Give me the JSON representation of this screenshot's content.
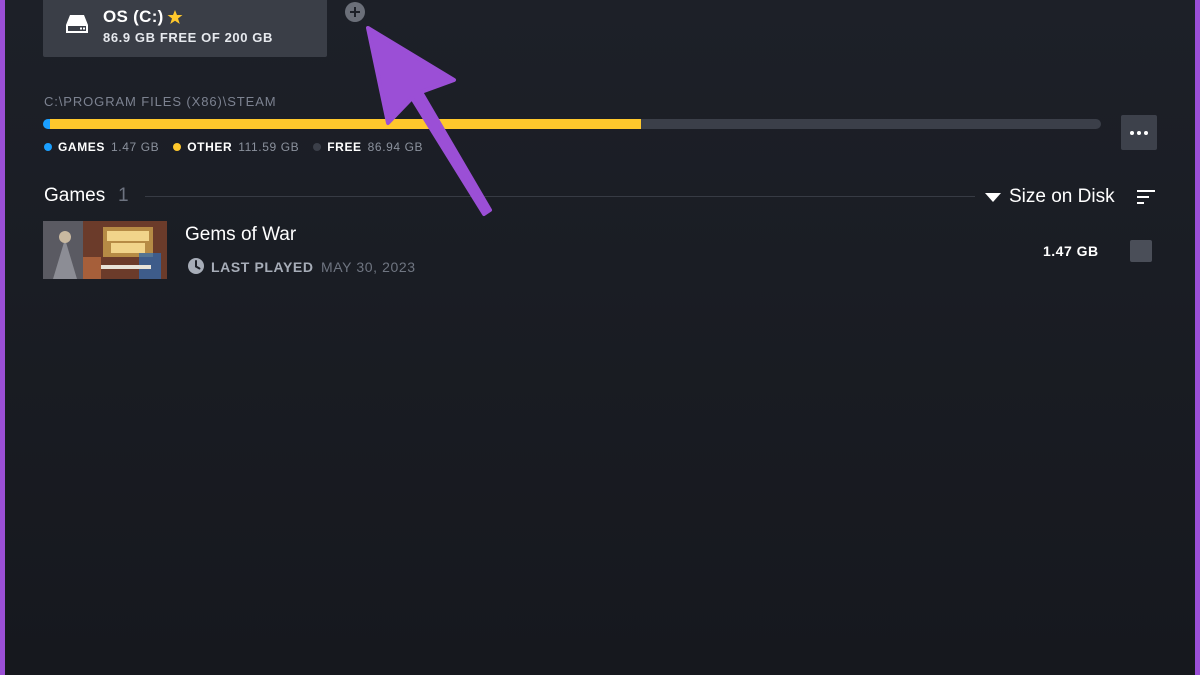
{
  "drive": {
    "name": "OS (C:)",
    "free_text": "86.9 GB FREE OF 200 GB",
    "icon": "hard-drive-icon",
    "default_marker_icon": "star-icon"
  },
  "add_drive": {
    "icon": "plus-circle-icon"
  },
  "storage": {
    "path": "C:\\PROGRAM FILES (X86)\\STEAM",
    "usage_fraction": {
      "games": 0.007,
      "other": 0.558,
      "free": 0.435
    },
    "legend": [
      {
        "key": "GAMES",
        "value": "1.47 GB",
        "color": "#1a9fff"
      },
      {
        "key": "OTHER",
        "value": "111.59 GB",
        "color": "#ffc82c"
      },
      {
        "key": "FREE",
        "value": "86.94 GB",
        "color": "#3b3f49"
      }
    ],
    "more_icon": "more-dots-icon"
  },
  "games_section": {
    "title": "Games",
    "count": "1",
    "sort_label": "Size on Disk",
    "sort_icon": "sort-lines-icon"
  },
  "games": [
    {
      "name": "Gems of War",
      "last_played_label": "LAST PLAYED",
      "last_played_date": "MAY 30, 2023",
      "size": "1.47 GB",
      "icon": "clock-icon"
    }
  ],
  "colors": {
    "background": "#1d2028",
    "accent_games": "#1a9fff",
    "accent_other": "#ffc82c",
    "annotation_arrow": "#9b4fd6"
  }
}
